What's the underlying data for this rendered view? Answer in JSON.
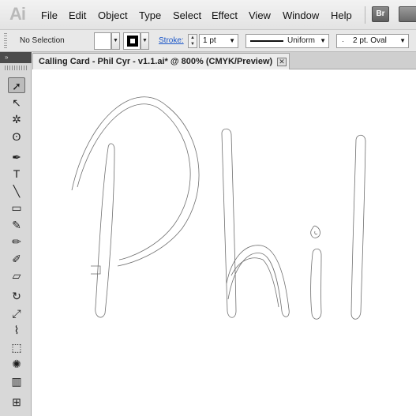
{
  "app": {
    "logo": "Ai",
    "bridge_button": "Br"
  },
  "menu": [
    "File",
    "Edit",
    "Object",
    "Type",
    "Select",
    "Effect",
    "View",
    "Window",
    "Help"
  ],
  "control_bar": {
    "selection_status": "No Selection",
    "stroke_label": "Stroke:",
    "stroke_weight": "1 pt",
    "stroke_profile": "Uniform",
    "brush": "2 pt. Oval",
    "fill_color": "#ffffff",
    "stroke_color": "#000000"
  },
  "toolbox": {
    "collapse_label": "»",
    "tools": [
      {
        "name": "selection-tool",
        "glyph": "➚"
      },
      {
        "name": "direct-selection-tool",
        "glyph": "↖"
      },
      {
        "name": "magic-wand-tool",
        "glyph": "✲"
      },
      {
        "name": "lasso-tool",
        "glyph": "ʘ"
      },
      {
        "name": "pen-tool",
        "glyph": "✒"
      },
      {
        "name": "type-tool",
        "glyph": "T"
      },
      {
        "name": "line-segment-tool",
        "glyph": "╲"
      },
      {
        "name": "rectangle-tool",
        "glyph": "▭"
      },
      {
        "name": "paintbrush-tool",
        "glyph": "✎"
      },
      {
        "name": "pencil-tool",
        "glyph": "✏"
      },
      {
        "name": "blob-brush-tool",
        "glyph": "✐"
      },
      {
        "name": "eraser-tool",
        "glyph": "▱"
      },
      {
        "name": "rotate-tool",
        "glyph": "↻"
      },
      {
        "name": "scale-tool",
        "glyph": "⤢"
      },
      {
        "name": "warp-tool",
        "glyph": "⌇"
      },
      {
        "name": "free-transform-tool",
        "glyph": "⬚"
      },
      {
        "name": "symbol-sprayer-tool",
        "glyph": "✺"
      },
      {
        "name": "column-graph-tool",
        "glyph": "▥"
      },
      {
        "name": "mesh-tool",
        "glyph": "⊞"
      },
      {
        "name": "gradient-tool",
        "glyph": "▬"
      }
    ]
  },
  "document": {
    "tab_title": "Calling Card - Phil Cyr - v1.1.ai* @ 800% (CMYK/Preview)",
    "close_glyph": "✕"
  },
  "colors": {
    "menubar": "#e8e8e8",
    "toolbox": "#d8d8d8",
    "stroke_link": "#1a56c8",
    "outline": "#6f6f6f"
  }
}
